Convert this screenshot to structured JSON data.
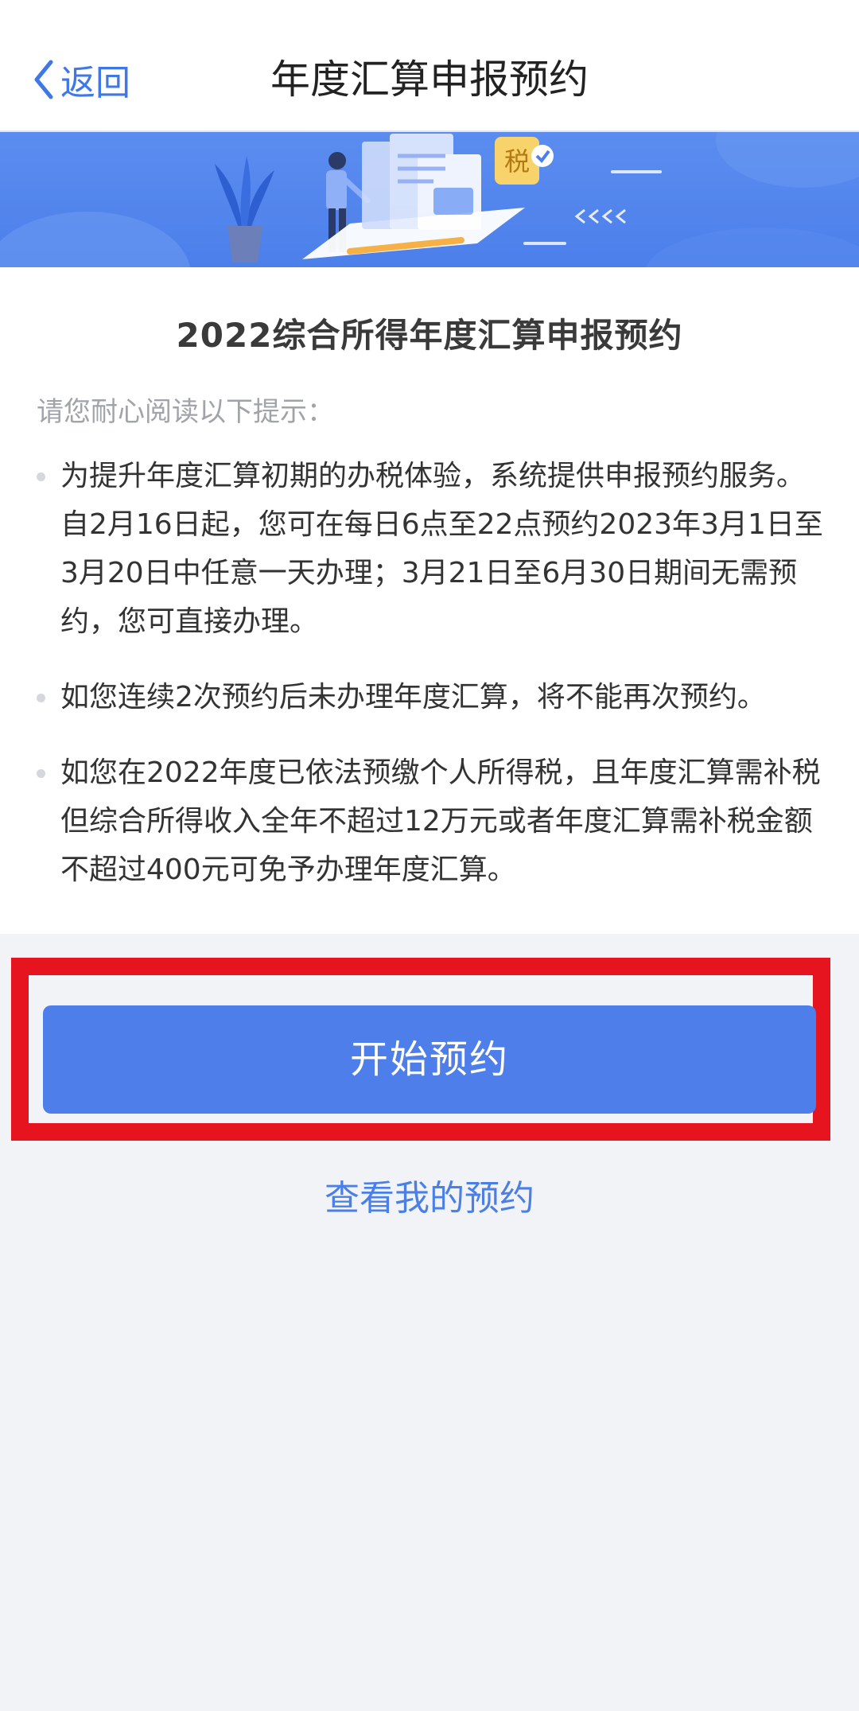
{
  "nav": {
    "back_label": "返回",
    "title": "年度汇算申报预约"
  },
  "banner": {
    "tax_badge": "税"
  },
  "content": {
    "title": "2022综合所得年度汇算申报预约",
    "hint": "请您耐心阅读以下提示：",
    "bullets": [
      "为提升年度汇算初期的办税体验，系统提供申报预约服务。自2月16日起，您可在每日6点至22点预约2023年3月1日至3月20日中任意一天办理；3月21日至6月30日期间无需预约，您可直接办理。",
      "如您连续2次预约后未办理年度汇算，将不能再次预约。",
      "如您在2022年度已依法预缴个人所得税，且年度汇算需补税但综合所得收入全年不超过12万元或者年度汇算需补税金额不超过400元可免予办理年度汇算。"
    ]
  },
  "actions": {
    "start_label": "开始预约",
    "view_label": "查看我的预约"
  },
  "colors": {
    "accent": "#4d7ee9",
    "highlight": "#e6141f",
    "background": "#f2f3f6"
  }
}
